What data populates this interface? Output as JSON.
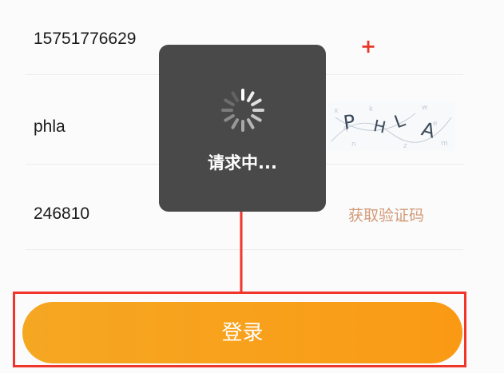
{
  "form": {
    "phone_value": "15751776629",
    "captcha_value": "phla",
    "sms_code_value": "246810",
    "captcha_image_text": "PHLA",
    "sms_link_label": "获取验证码",
    "add_symbol": "+"
  },
  "toast": {
    "message": "请求中..."
  },
  "login_button": {
    "label": "登录"
  },
  "colors": {
    "accent_orange": "#f8a11c",
    "highlight_red": "#f0352a",
    "toast_bg": "#494949",
    "link_color": "#d19a78"
  },
  "icons": {
    "spinner": "loading-spinner-icon",
    "plus": "plus-icon",
    "arrow": "annotation-arrow"
  }
}
